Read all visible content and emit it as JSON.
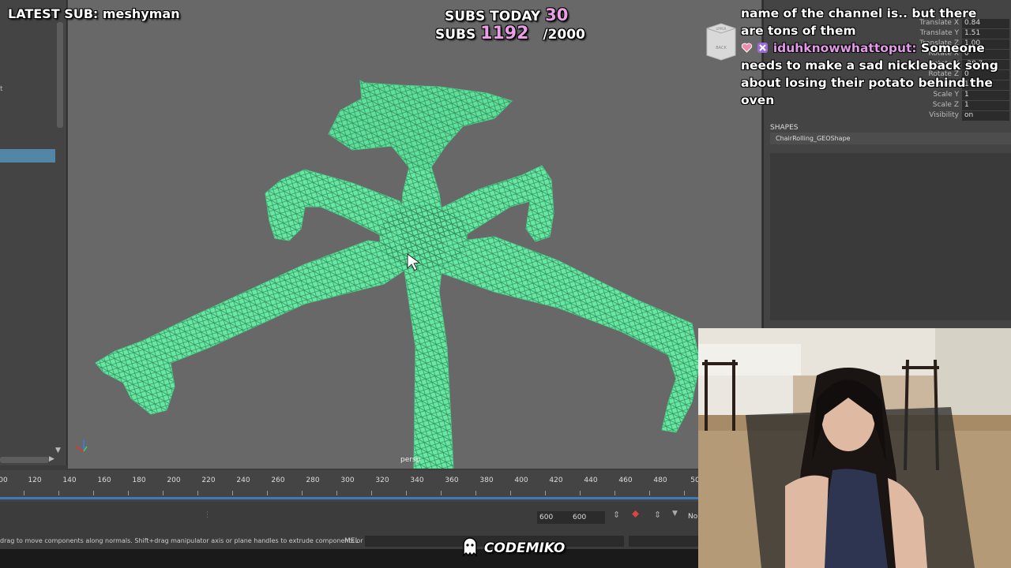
{
  "overlay": {
    "latest_sub": "LATEST SUB: meshyman",
    "subs_today_label": "SUBS TODAY",
    "subs_today_value": "30",
    "subs_label": "SUBS",
    "subs_value": "1192",
    "subs_goal": "/2000",
    "brand": "CODEMIKO"
  },
  "chat": [
    {
      "username": "",
      "text": "name of the channel is.. but there are tons of them"
    },
    {
      "username": "iduhknowwhattoput:",
      "text": "Someone needs to make a sad nickleback song about losing their potato behind the oven"
    }
  ],
  "viewport": {
    "camera_label": "persp",
    "wireframe_color": "#66e8a2",
    "background_color": "#686868"
  },
  "viewcube": {
    "faces": [
      "UPPER",
      "BACK"
    ]
  },
  "outliner": {
    "partial_text": "t"
  },
  "attributes": {
    "rows": [
      {
        "label": "Translate X",
        "value": "0.84"
      },
      {
        "label": "Translate Y",
        "value": "1.51"
      },
      {
        "label": "Translate Z",
        "value": "1.00"
      },
      {
        "label": "Rotate X",
        "value": "0"
      },
      {
        "label": "Rotate Y",
        "value": "-28.7"
      },
      {
        "label": "Rotate Z",
        "value": "0"
      },
      {
        "label": "Scale X",
        "value": "1"
      },
      {
        "label": "Scale Y",
        "value": "1"
      },
      {
        "label": "Scale Z",
        "value": "1"
      },
      {
        "label": "Visibility",
        "value": "on"
      }
    ],
    "shapes_header": "SHAPES",
    "shape_name": "ChairRolling_GEOShape"
  },
  "timeline": {
    "ticks": [
      "00",
      "120",
      "140",
      "160",
      "180",
      "200",
      "220",
      "240",
      "260",
      "280",
      "300",
      "320",
      "340",
      "360",
      "380",
      "400",
      "420",
      "440",
      "460",
      "480",
      "50"
    ],
    "range_start": "600",
    "range_end": "600",
    "right_label": "No"
  },
  "status": {
    "hint": "drag to move components along normals. Shift+drag manipulator axis or plane handles to extrude components or c",
    "mel_label": "MEL"
  },
  "colors": {
    "accent": "#5285a6",
    "timeline_bar": "#3a7bbd",
    "chat_username": "#e39ae8",
    "subs_value": "#e9a0e6"
  }
}
